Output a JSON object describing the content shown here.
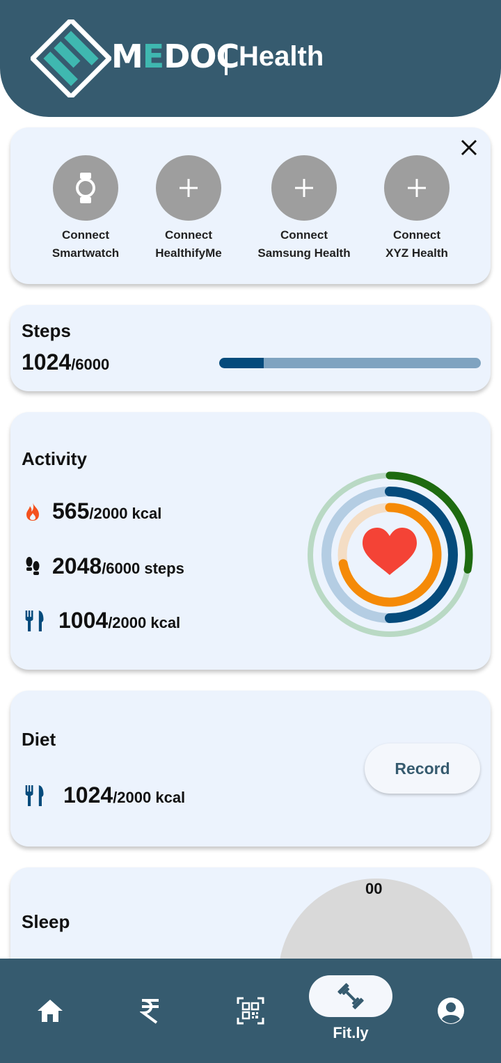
{
  "header": {
    "brand_prefix": "M",
    "brand_accent": "E",
    "brand_suffix": "DOC",
    "subtitle": "Health"
  },
  "connect_card": {
    "items": [
      {
        "line1": "Connect",
        "line2": "Smartwatch",
        "icon": "watch-icon"
      },
      {
        "line1": "Connect",
        "line2": "HealthifyMe",
        "icon": "plus-icon"
      },
      {
        "line1": "Connect",
        "line2": "Samsung Health",
        "icon": "plus-icon"
      },
      {
        "line1": "Connect",
        "line2": "XYZ Health",
        "icon": "plus-icon"
      }
    ]
  },
  "steps": {
    "title": "Steps",
    "current": "1024",
    "goal": "/6000",
    "progress": 0.17
  },
  "activity": {
    "title": "Activity",
    "rows": [
      {
        "icon": "flame-icon",
        "value": "565",
        "unit": "/2000 kcal"
      },
      {
        "icon": "footsteps-icon",
        "value": "2048",
        "unit": "/6000 steps"
      },
      {
        "icon": "utensils-icon",
        "value": "1004",
        "unit": "/2000 kcal"
      }
    ],
    "rings": {
      "outer_fraction": 0.28,
      "middle_fraction": 0.5,
      "inner_fraction": 0.72
    }
  },
  "diet": {
    "title": "Diet",
    "value": "1024",
    "unit": "/2000 kcal",
    "record_label": "Record"
  },
  "sleep": {
    "title": "Sleep",
    "dial_label": "00"
  },
  "nav": {
    "active_label": "Fit.ly"
  },
  "colors": {
    "primary": "#365b6f",
    "card_bg": "#ecf3fd",
    "accent_teal": "#3fb8b0",
    "progress_fill": "#054b7c",
    "ring_green": "#1e6b10",
    "ring_blue": "#054b7c",
    "ring_orange": "#f58a07",
    "heart": "#f44336"
  }
}
